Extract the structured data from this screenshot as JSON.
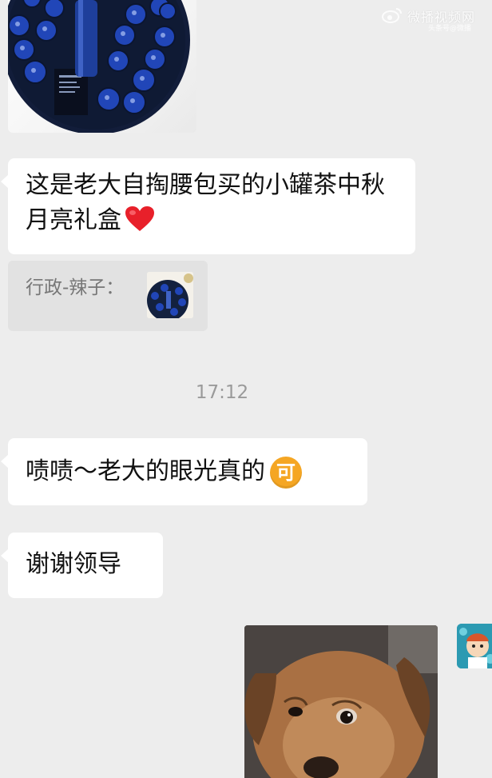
{
  "watermark": {
    "text": "微播视频网",
    "sub": "头条号@微播"
  },
  "messages": {
    "gift_image": {
      "icon": "gift-box-photo"
    },
    "msg1": {
      "text": "这是老大自掏腰包买的小罐茶中秋月亮礼盒",
      "emoji": "red-heart-icon"
    },
    "quote": {
      "label": "行政-辣子：",
      "thumb_icon": "gift-box-thumbnail"
    },
    "timestamp": "17:12",
    "msg2": {
      "text": "啧啧～老大的眼光真的",
      "emoji_text": "可"
    },
    "msg3": {
      "text": "谢谢领导"
    },
    "dog_image": {
      "icon": "puppy-sticker-photo"
    },
    "sender_avatar": {
      "icon": "avatar-cartoon"
    }
  },
  "colors": {
    "background": "#ededed",
    "bubble": "#ffffff",
    "quote_bg": "#e2e2e2",
    "heart": "#e8202a",
    "emoji_orange": "#f5a623",
    "gift_blue": "#1f3a93"
  }
}
